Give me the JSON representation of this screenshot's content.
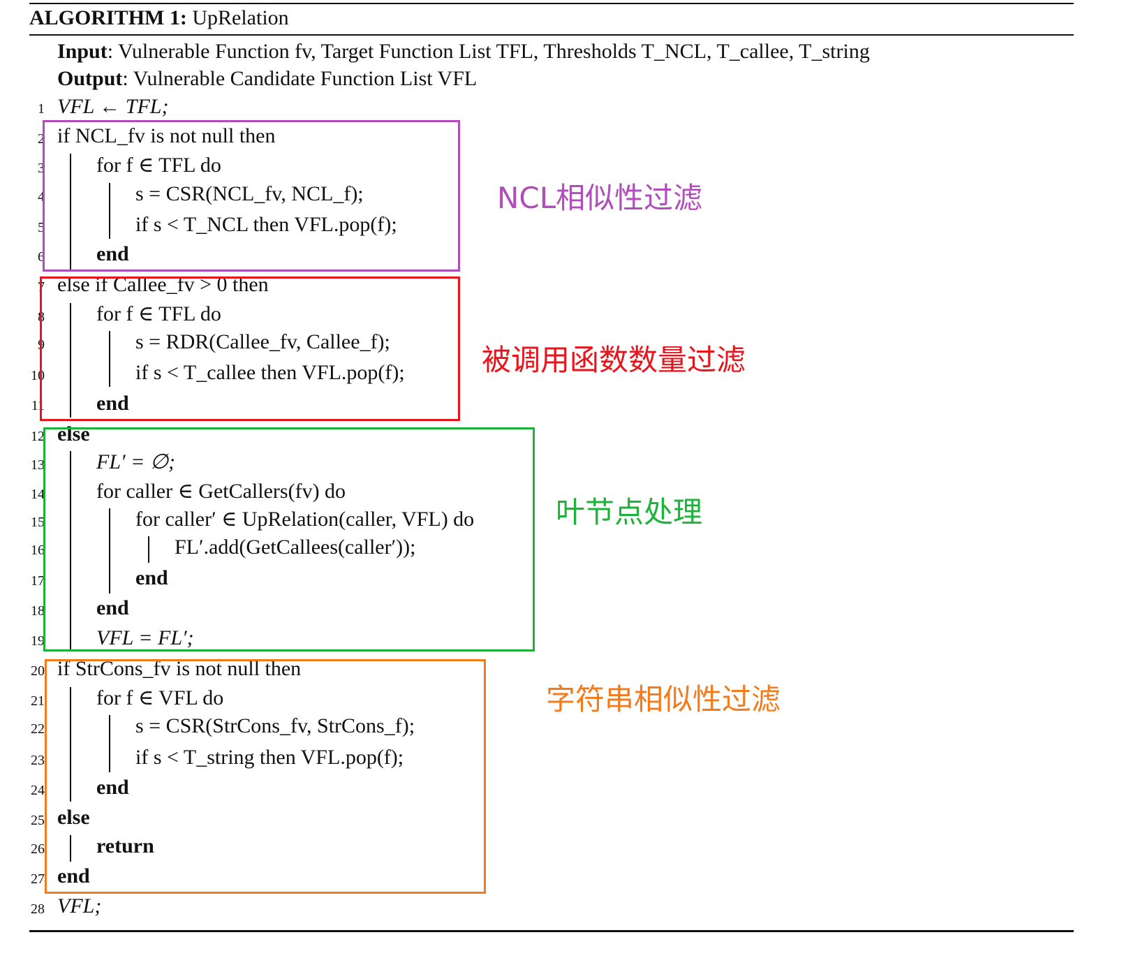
{
  "algorithm": {
    "label": "ALGORITHM 1:",
    "name": "UpRelation",
    "input_label": "Input",
    "input_text": ": Vulnerable Function fv, Target Function List TFL, Thresholds T_NCL, T_callee, T_string",
    "output_label": "Output",
    "output_text": ": Vulnerable Candidate Function List VFL"
  },
  "lines": [
    {
      "n": "1",
      "text": "VFL ← TFL;"
    },
    {
      "n": "2",
      "text": "if NCL_fv is not null then"
    },
    {
      "n": "3",
      "text": "for f ∈ TFL do"
    },
    {
      "n": "4",
      "text": "s = CSR(NCL_fv, NCL_f);"
    },
    {
      "n": "5",
      "text": "if s < T_NCL then VFL.pop(f);"
    },
    {
      "n": "6",
      "text": "end"
    },
    {
      "n": "7",
      "text": "else if Callee_fv > 0 then"
    },
    {
      "n": "8",
      "text": "for f ∈ TFL do"
    },
    {
      "n": "9",
      "text": "s = RDR(Callee_fv, Callee_f);"
    },
    {
      "n": "10",
      "text": "if s < T_callee then VFL.pop(f);"
    },
    {
      "n": "11",
      "text": "end"
    },
    {
      "n": "12",
      "text": "else"
    },
    {
      "n": "13",
      "text": "FL′ = ∅;"
    },
    {
      "n": "14",
      "text": "for caller ∈ GetCallers(fv) do"
    },
    {
      "n": "15",
      "text": "for caller′ ∈ UpRelation(caller, VFL) do"
    },
    {
      "n": "16",
      "text": "FL′.add(GetCallees(caller′));"
    },
    {
      "n": "17",
      "text": "end"
    },
    {
      "n": "18",
      "text": "end"
    },
    {
      "n": "19",
      "text": "VFL = FL′;"
    },
    {
      "n": "20",
      "text": "if StrCons_fv is not null then"
    },
    {
      "n": "21",
      "text": "for f ∈ VFL do"
    },
    {
      "n": "22",
      "text": "s = CSR(StrCons_fv, StrCons_f);"
    },
    {
      "n": "23",
      "text": "if s < T_string then VFL.pop(f);"
    },
    {
      "n": "24",
      "text": "end"
    },
    {
      "n": "25",
      "text": "else"
    },
    {
      "n": "26",
      "text": "return"
    },
    {
      "n": "27",
      "text": "end"
    },
    {
      "n": "28",
      "text": "VFL;"
    }
  ],
  "annotations": [
    {
      "text": "NCL相似性过滤",
      "color": "#b04dbb"
    },
    {
      "text": "被调用函数数量过滤",
      "color": "#e8141c"
    },
    {
      "text": "叶节点处理",
      "color": "#1db33a"
    },
    {
      "text": "字符串相似性过滤",
      "color": "#f47b1c"
    }
  ]
}
